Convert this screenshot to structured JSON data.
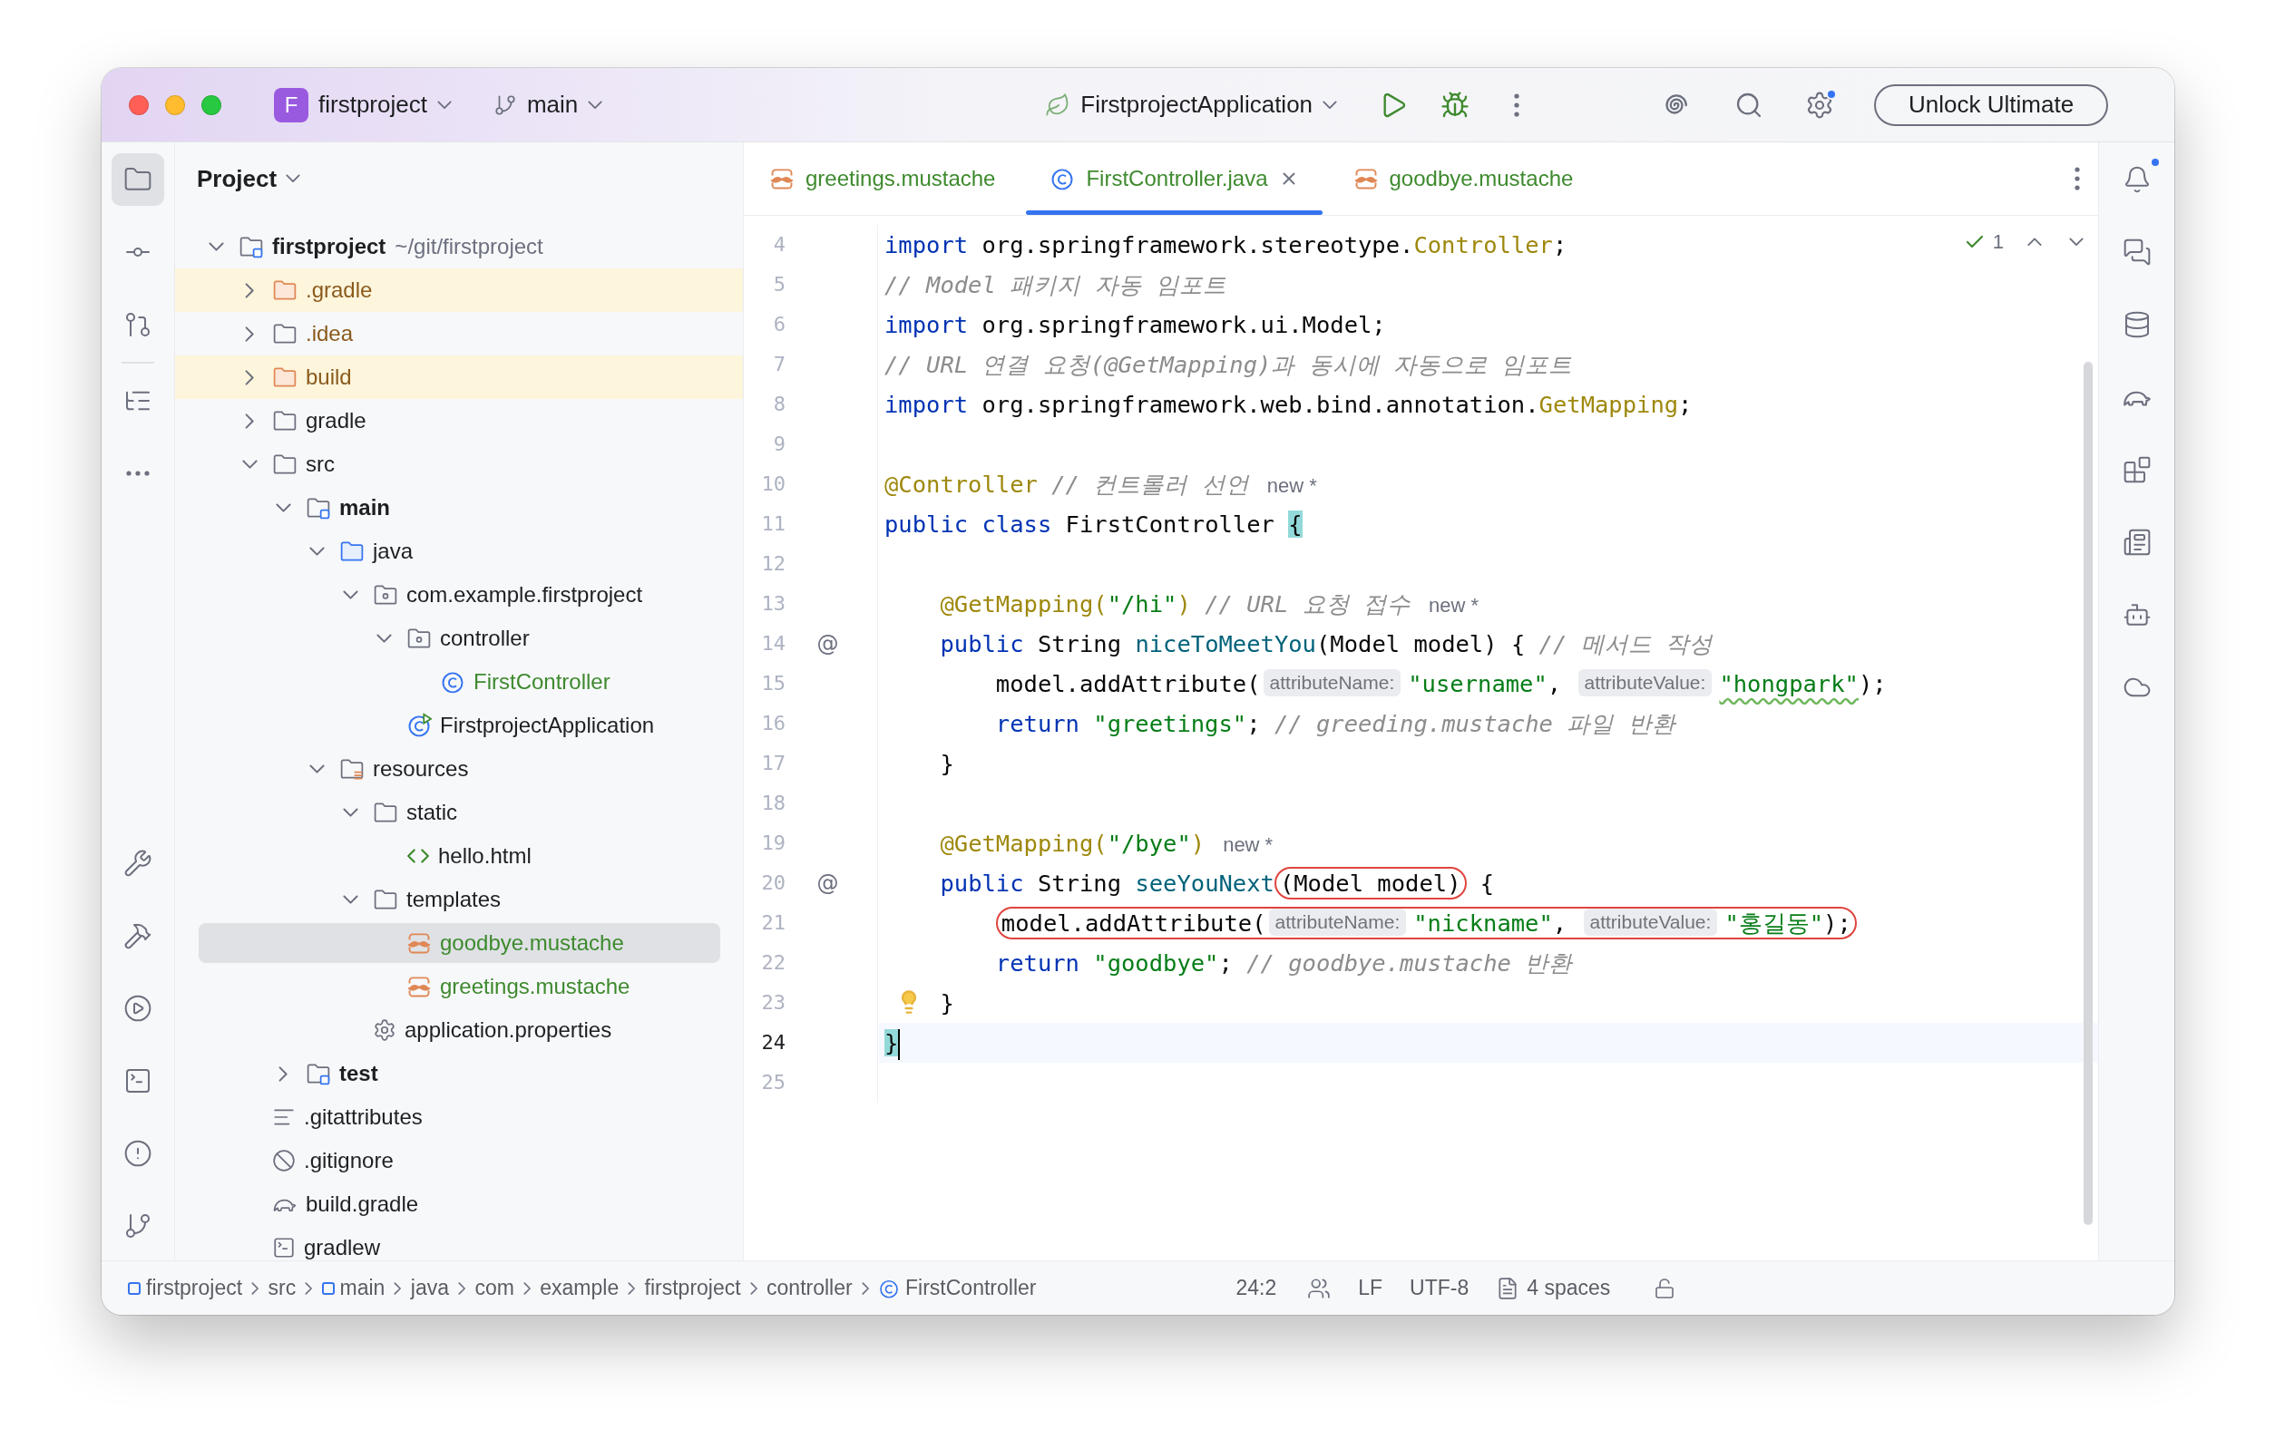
{
  "title_bar": {
    "project_badge": "F",
    "project": "firstproject",
    "branch": "main",
    "run_config": "FirstprojectApplication",
    "settings_badge": true,
    "button": "Unlock Ultimate"
  },
  "left_toolbar": {
    "top": [
      [
        {
          "kind": "project",
          "selected": true
        },
        {
          "kind": "commit",
          "selected": false
        },
        {
          "kind": "pull-requests",
          "selected": false
        }
      ],
      [
        {
          "kind": "structure",
          "selected": false
        },
        {
          "kind": "more",
          "selected": false
        }
      ]
    ],
    "bottom": [
      {
        "kind": "build",
        "selected": false
      },
      {
        "kind": "hammer",
        "selected": false
      },
      {
        "kind": "services",
        "selected": false
      },
      {
        "kind": "terminal",
        "selected": false
      },
      {
        "kind": "problems",
        "selected": false
      },
      {
        "kind": "git",
        "selected": false
      }
    ]
  },
  "project_panel": {
    "title": "Project",
    "tree": [
      {
        "kind": "module",
        "label": "firstproject",
        "path": "~/git/firstproject",
        "color": "#1e1f22",
        "selected": false,
        "expanded": true,
        "children": [
          {
            "kind": "folder",
            "label": ".gradle",
            "color": "#8a5a1c",
            "excluded": true,
            "selected": false,
            "expanded": false
          },
          {
            "kind": "folder",
            "label": ".idea",
            "color": "#8a5a1c",
            "excluded": false,
            "selected": false,
            "expanded": false
          },
          {
            "kind": "folder",
            "label": "build",
            "color": "#8a5a1c",
            "excluded": true,
            "selected": false,
            "expanded": false
          },
          {
            "kind": "folder",
            "label": "gradle",
            "color": "#1e1f22",
            "excluded": false,
            "selected": false,
            "expanded": false
          },
          {
            "kind": "folder",
            "label": "src",
            "color": "#1e1f22",
            "excluded": false,
            "selected": false,
            "expanded": true,
            "children": [
              {
                "kind": "module",
                "label": "main",
                "color": "#1e1f22",
                "selected": false,
                "expanded": true,
                "children": [
                  {
                    "kind": "source-root",
                    "label": "java",
                    "color": "#1e1f22",
                    "selected": false,
                    "expanded": true,
                    "children": [
                      {
                        "kind": "package",
                        "label": "com.example.firstproject",
                        "color": "#1e1f22",
                        "selected": false,
                        "expanded": true,
                        "children": [
                          {
                            "kind": "package",
                            "label": "controller",
                            "color": "#1e1f22",
                            "selected": false,
                            "expanded": true,
                            "children": [
                              {
                                "kind": "class",
                                "label": "FirstController",
                                "color": "#3e8a2e",
                                "selected": false
                              }
                            ]
                          },
                          {
                            "kind": "spring-app",
                            "label": "FirstprojectApplication",
                            "color": "#1e1f22",
                            "selected": false
                          }
                        ]
                      }
                    ]
                  },
                  {
                    "kind": "resources",
                    "label": "resources",
                    "color": "#1e1f22",
                    "selected": false,
                    "expanded": true,
                    "children": [
                      {
                        "kind": "folder",
                        "label": "static",
                        "color": "#1e1f22",
                        "selected": false,
                        "expanded": true,
                        "children": [
                          {
                            "kind": "html",
                            "label": "hello.html",
                            "color": "#1e1f22",
                            "selected": false
                          }
                        ]
                      },
                      {
                        "kind": "folder",
                        "label": "templates",
                        "color": "#1e1f22",
                        "selected": false,
                        "expanded": true,
                        "children": [
                          {
                            "kind": "mustache",
                            "label": "goodbye.mustache",
                            "color": "#3e8a2e",
                            "selected": true
                          },
                          {
                            "kind": "mustache",
                            "label": "greetings.mustache",
                            "color": "#3e8a2e",
                            "selected": false
                          }
                        ]
                      },
                      {
                        "kind": "properties",
                        "label": "application.properties",
                        "color": "#1e1f22",
                        "selected": false
                      }
                    ]
                  }
                ]
              },
              {
                "kind": "module",
                "label": "test",
                "color": "#1e1f22",
                "selected": false,
                "expanded": false
              }
            ]
          },
          {
            "kind": "text-file",
            "label": ".gitattributes",
            "color": "#1e1f22",
            "excluded": false,
            "selected": false
          },
          {
            "kind": "ignore-file",
            "label": ".gitignore",
            "color": "#1e1f22",
            "excluded": false,
            "selected": false
          },
          {
            "kind": "gradle-file",
            "label": "build.gradle",
            "color": "#1e1f22",
            "excluded": false,
            "selected": false
          },
          {
            "kind": "script",
            "label": "gradlew",
            "color": "#1e1f22",
            "excluded": false,
            "selected": false
          }
        ]
      }
    ]
  },
  "editor": {
    "tabs": [
      {
        "kind": "mustache",
        "label": "greetings.mustache",
        "color": "#3e8a2e",
        "selected": false,
        "closable": false
      },
      {
        "kind": "class",
        "label": "FirstController.java",
        "color": "#3e8a2e",
        "selected": true,
        "closable": true
      },
      {
        "kind": "mustache",
        "label": "goodbye.mustache",
        "color": "#3e8a2e",
        "selected": false,
        "closable": false
      }
    ],
    "inspection": {
      "count": "1"
    },
    "lines": [
      {
        "number": "4",
        "current": false,
        "tokens": [
          {
            "kind": "keyword",
            "text": "import"
          },
          {
            "kind": "plain",
            "text": " org.springframework.stereotype."
          },
          {
            "kind": "type",
            "text": "Controller"
          },
          {
            "kind": "plain",
            "text": ";"
          }
        ]
      },
      {
        "number": "5",
        "current": false,
        "tokens": [
          {
            "kind": "comment",
            "text": "// Model 패키지 자동 임포트"
          }
        ]
      },
      {
        "number": "6",
        "current": false,
        "tokens": [
          {
            "kind": "keyword",
            "text": "import"
          },
          {
            "kind": "plain",
            "text": " org.springframework.ui.Model;"
          }
        ]
      },
      {
        "number": "7",
        "current": false,
        "tokens": [
          {
            "kind": "comment",
            "text": "// URL 연결 요청(@GetMapping)과 동시에 자동으로 임포트"
          }
        ]
      },
      {
        "number": "8",
        "current": false,
        "tokens": [
          {
            "kind": "keyword",
            "text": "import"
          },
          {
            "kind": "plain",
            "text": " org.springframework.web.bind.annotation."
          },
          {
            "kind": "type",
            "text": "GetMapping"
          },
          {
            "kind": "plain",
            "text": ";"
          }
        ]
      },
      {
        "number": "9",
        "current": false
      },
      {
        "number": "10",
        "current": false,
        "tokens": [
          {
            "kind": "annotation",
            "text": "@Controller"
          },
          {
            "kind": "comment",
            "text": " // 컨트롤러 선언"
          },
          {
            "kind": "author",
            "text": "new *"
          }
        ]
      },
      {
        "number": "11",
        "current": false,
        "tokens": [
          {
            "kind": "keyword",
            "text": "public"
          },
          {
            "kind": "keyword",
            "text": " class"
          },
          {
            "kind": "plain",
            "text": " FirstController "
          },
          {
            "kind": "brace",
            "text": "{"
          }
        ]
      },
      {
        "number": "12",
        "current": false
      },
      {
        "number": "13",
        "current": false,
        "tokens": [
          {
            "kind": "annotation",
            "text": "    @GetMapping("
          },
          {
            "kind": "string",
            "text": "\"/hi\""
          },
          {
            "kind": "annotation",
            "text": ")"
          },
          {
            "kind": "comment",
            "text": " // URL 요청 접수"
          },
          {
            "kind": "author",
            "text": "new *"
          }
        ]
      },
      {
        "number": "14",
        "current": false,
        "gutter": "@",
        "tokens": [
          {
            "kind": "keyword",
            "text": "    public"
          },
          {
            "kind": "plain",
            "text": " String "
          },
          {
            "kind": "method",
            "text": "niceToMeetYou"
          },
          {
            "kind": "plain",
            "text": "(Model model) { "
          },
          {
            "kind": "comment",
            "text": "// 메서드 작성"
          }
        ]
      },
      {
        "number": "15",
        "current": false,
        "tokens": [
          {
            "kind": "plain",
            "text": "        model.addAttribute("
          },
          {
            "kind": "hint",
            "text": "attributeName:"
          },
          {
            "kind": "string",
            "text": "\"username\""
          },
          {
            "kind": "plain",
            "text": ", "
          },
          {
            "kind": "hint",
            "text": "attributeValue:"
          },
          {
            "kind": "string",
            "text": "\"hongpark\"",
            "typo": true
          },
          {
            "kind": "plain",
            "text": ");"
          }
        ]
      },
      {
        "number": "16",
        "current": false,
        "tokens": [
          {
            "kind": "keyword",
            "text": "        return"
          },
          {
            "kind": "string",
            "text": " \"greetings\""
          },
          {
            "kind": "plain",
            "text": "; "
          },
          {
            "kind": "comment",
            "text": "// greeding.mustache 파일 반환"
          }
        ]
      },
      {
        "number": "17",
        "current": false,
        "tokens": [
          {
            "kind": "plain",
            "text": "    }"
          }
        ]
      },
      {
        "number": "18",
        "current": false
      },
      {
        "number": "19",
        "current": false,
        "tokens": [
          {
            "kind": "annotation",
            "text": "    @GetMapping("
          },
          {
            "kind": "string",
            "text": "\"/bye\""
          },
          {
            "kind": "annotation",
            "text": ")"
          },
          {
            "kind": "author",
            "text": "new *"
          }
        ]
      },
      {
        "number": "20",
        "current": false,
        "gutter": "@",
        "tokens": [
          {
            "kind": "keyword",
            "text": "    public"
          },
          {
            "kind": "plain",
            "text": " String "
          },
          {
            "kind": "method",
            "text": "seeYouNext"
          },
          {
            "kind": "outline",
            "tokens": [
              {
                "kind": "plain",
                "text": "(Model model)"
              }
            ]
          },
          {
            "kind": "plain",
            "text": " {"
          }
        ]
      },
      {
        "number": "21",
        "current": false,
        "tokens": [
          {
            "kind": "outline",
            "tokens": [
              {
                "kind": "plain",
                "text": "        model.addAttribute("
              },
              {
                "kind": "hint",
                "text": "attributeName:"
              },
              {
                "kind": "string",
                "text": "\"nickname\""
              },
              {
                "kind": "plain",
                "text": ", "
              },
              {
                "kind": "hint",
                "text": "attributeValue:"
              },
              {
                "kind": "string",
                "text": "\"홍길동\""
              },
              {
                "kind": "plain",
                "text": ");"
              }
            ]
          }
        ]
      },
      {
        "number": "22",
        "current": false,
        "tokens": [
          {
            "kind": "keyword",
            "text": "        return"
          },
          {
            "kind": "string",
            "text": " \"goodbye\""
          },
          {
            "kind": "plain",
            "text": "; "
          },
          {
            "kind": "comment",
            "text": "// goodbye.mustache 반환"
          }
        ]
      },
      {
        "number": "23",
        "current": false,
        "bulb": true,
        "tokens": [
          {
            "kind": "plain",
            "text": "    }"
          }
        ]
      },
      {
        "number": "24",
        "current": true,
        "tokens": [
          {
            "kind": "brace",
            "text": "}"
          }
        ]
      },
      {
        "number": "25",
        "current": false
      }
    ]
  },
  "right_toolbar": [
    {
      "kind": "notifications",
      "badge": true
    },
    {
      "kind": "chat",
      "badge": false
    },
    {
      "kind": "database",
      "badge": false
    },
    {
      "kind": "gradle",
      "badge": false
    },
    {
      "kind": "blocks",
      "badge": false
    },
    {
      "kind": "endpoints",
      "badge": false
    },
    {
      "kind": "copilot",
      "badge": false
    },
    {
      "kind": "cloud",
      "badge": false
    }
  ],
  "status_bar": {
    "breadcrumbs": [
      {
        "kind": "module",
        "label": "firstproject"
      },
      {
        "kind": "plain",
        "label": "src"
      },
      {
        "kind": "module",
        "label": "main"
      },
      {
        "kind": "plain",
        "label": "java"
      },
      {
        "kind": "plain",
        "label": "com"
      },
      {
        "kind": "plain",
        "label": "example"
      },
      {
        "kind": "plain",
        "label": "firstproject"
      },
      {
        "kind": "plain",
        "label": "controller"
      },
      {
        "kind": "class",
        "label": "FirstController"
      }
    ],
    "position": "24:2",
    "line_separator": "LF",
    "encoding": "UTF-8",
    "indent": "4 spaces"
  }
}
